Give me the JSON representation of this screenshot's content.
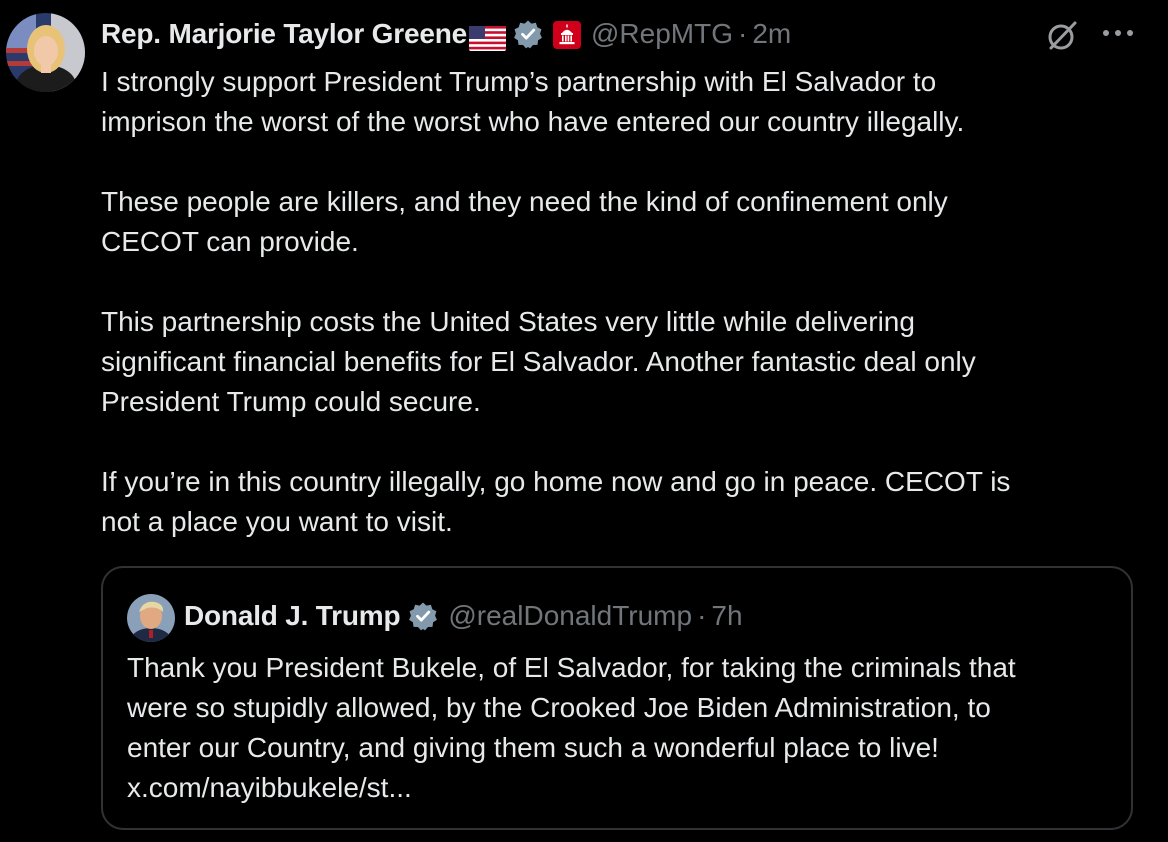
{
  "post": {
    "author": {
      "name": "Rep. Marjorie Taylor Greene",
      "handle": "@RepMTG",
      "separator": "·",
      "time": "2m"
    },
    "paragraphs": [
      "I strongly support President Trump’s partnership with El Salvador to\nimprison the worst of the worst who have entered our country illegally.",
      "These people are killers, and they need the kind of confinement only\nCECOT can provide.",
      "This partnership costs the United States very little while delivering\nsignificant financial benefits for El Salvador. Another fantastic deal only\nPresident Trump could secure.",
      "If you’re in this country illegally, go home now and go in peace. CECOT is\nnot a place you want to visit."
    ],
    "actions": {
      "more_label": "•••"
    }
  },
  "quote": {
    "author": {
      "name": "Donald J. Trump",
      "handle": "@realDonaldTrump",
      "separator": "·",
      "time": "7h"
    },
    "text": "Thank you President Bukele, of El Salvador, for taking the criminals that\nwere so stupidly allowed, by the Crooked Joe Biden Administration, to\nenter our Country, and giving them such a wonderful place to live!\nx.com/nayibbukele/st..."
  },
  "colors": {
    "background": "#000000",
    "text": "#e7e9ea",
    "secondary_text": "#71767b",
    "verified_badge": "#829aab",
    "government_badge": "#d0001b",
    "border": "#2f3336"
  },
  "icons": [
    "avatar",
    "us-flag-emoji",
    "verified-badge-icon",
    "government-capitol-badge-icon",
    "grok-icon",
    "more-options-icon"
  ]
}
